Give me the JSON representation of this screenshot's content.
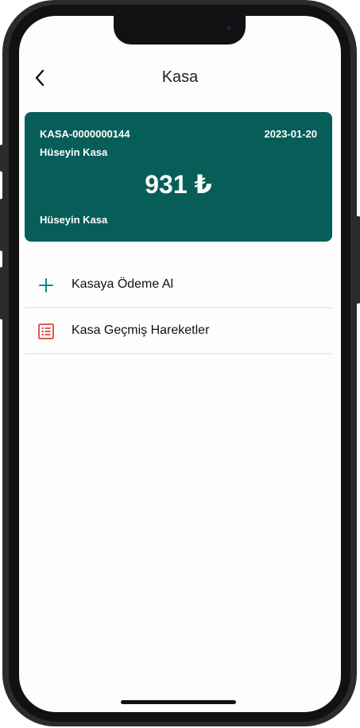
{
  "header": {
    "title": "Kasa"
  },
  "card": {
    "code": "KASA-0000000144",
    "date": "2023-01-20",
    "holder_top": "Hüseyin Kasa",
    "amount": "931 ₺",
    "holder_bottom": "Hüseyin Kasa",
    "background_color": "#075e58"
  },
  "menu": {
    "items": [
      {
        "label": "Kasaya Ödeme Al",
        "icon": "plus-icon",
        "icon_color": "#0b8a84"
      },
      {
        "label": "Kasa Geçmiş Hareketler",
        "icon": "list-icon",
        "icon_color": "#e0443e"
      }
    ]
  }
}
